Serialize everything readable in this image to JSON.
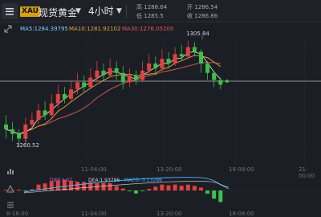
{
  "toolbar": {
    "symbol_badge": "XAU",
    "symbol_name": "现货黄金",
    "timeframe": "4小时",
    "ohlc": {
      "high_label": "高",
      "high": "1288.64",
      "low_label": "低",
      "low": "1285.5",
      "open_label": "开",
      "open": "1286.54",
      "close_label": "收",
      "close": "1286.86"
    },
    "menu_icon": "hamburger-icon",
    "dropdown_glyph": "▼"
  },
  "ma_legend": {
    "ma5": "MA5:1284.39795",
    "ma10": "MA10:1281.92102",
    "ma30": "MA30:1276.05200"
  },
  "chart": {
    "high_annotation": "1305.84",
    "low_annotation": "1260.52",
    "x_labels": [
      "11-04:00",
      "13-20:00",
      "18-08:00",
      "21-00:00"
    ],
    "bottom_x_labels": [
      "8-16:00",
      "11-04:00",
      "13-20:00",
      "18-08:00"
    ]
  },
  "macd": {
    "dea": "DEA:1.93796",
    "macd": "MACD:-3.13286",
    "diff": "DIFF:1.07..."
  },
  "colors": {
    "up": "#e0413f",
    "down": "#3fbf4a",
    "ma5": "#d7d7d7",
    "ma10": "#e8a33c",
    "ma30": "#e05a5a",
    "accent": "#4ab0ff"
  },
  "chart_data": {
    "type": "candlestick",
    "series": [
      {
        "name": "MA5"
      },
      {
        "name": "MA10"
      },
      {
        "name": "MA30"
      }
    ],
    "candles": [
      [
        1270,
        1268,
        1274,
        1264
      ],
      [
        1268,
        1266,
        1271,
        1263
      ],
      [
        1266,
        1264,
        1268,
        1260.52
      ],
      [
        1264,
        1270,
        1273,
        1262
      ],
      [
        1270,
        1272,
        1275,
        1268
      ],
      [
        1272,
        1276,
        1279,
        1270
      ],
      [
        1276,
        1274,
        1280,
        1272
      ],
      [
        1274,
        1279,
        1283,
        1273
      ],
      [
        1279,
        1283,
        1287,
        1277
      ],
      [
        1283,
        1281,
        1286,
        1279
      ],
      [
        1281,
        1285,
        1289,
        1280
      ],
      [
        1285,
        1288,
        1292,
        1283
      ],
      [
        1288,
        1286,
        1291,
        1284
      ],
      [
        1286,
        1290,
        1294,
        1285
      ],
      [
        1290,
        1293,
        1297,
        1288
      ],
      [
        1293,
        1291,
        1296,
        1289
      ],
      [
        1291,
        1294,
        1298,
        1290
      ],
      [
        1294,
        1292,
        1297,
        1289
      ],
      [
        1292,
        1288,
        1295,
        1285
      ],
      [
        1288,
        1291,
        1294,
        1286
      ],
      [
        1291,
        1289,
        1293,
        1287
      ],
      [
        1289,
        1293,
        1297,
        1288
      ],
      [
        1293,
        1296,
        1300,
        1292
      ],
      [
        1296,
        1294,
        1299,
        1291
      ],
      [
        1294,
        1298,
        1302,
        1293
      ],
      [
        1298,
        1296,
        1301,
        1294
      ],
      [
        1296,
        1300,
        1303,
        1295
      ],
      [
        1300,
        1299,
        1304,
        1297
      ],
      [
        1299,
        1303,
        1305.84,
        1298
      ],
      [
        1303,
        1301,
        1305,
        1299
      ],
      [
        1301,
        1296,
        1302,
        1292
      ],
      [
        1296,
        1292,
        1297,
        1289
      ],
      [
        1292,
        1289,
        1293,
        1286
      ],
      [
        1289,
        1287,
        1290,
        1285
      ]
    ]
  }
}
